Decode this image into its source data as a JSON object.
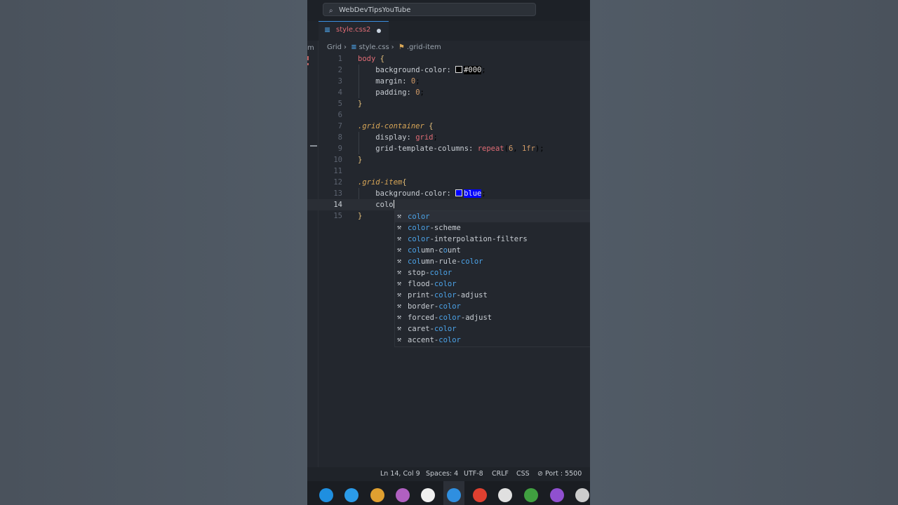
{
  "titlebar": {
    "search_text": "WebDevTipsYouTube"
  },
  "tab": {
    "label": "style.css",
    "problem_count": "2"
  },
  "sidebar_partial_text": "m",
  "breadcrumb": {
    "folder": "Grid",
    "file": "style.css",
    "symbol": ".grid-item"
  },
  "code_lines": [
    {
      "n": "1",
      "html": "<span class='sel'>body</span> <span class='brace'>{</span>"
    },
    {
      "n": "2",
      "html": "    <span class='prop'>background-color:</span> <span class='swatch' style='background:#000'></span><span class='hl-black'>#000</span>;"
    },
    {
      "n": "3",
      "html": "    <span class='prop'>margin:</span> <span class='num'>0</span>;"
    },
    {
      "n": "4",
      "html": "    <span class='prop'>padding:</span> <span class='num'>0</span>;"
    },
    {
      "n": "5",
      "html": "<span class='brace'>}</span>"
    },
    {
      "n": "6",
      "html": ""
    },
    {
      "n": "7",
      "html": "<span class='selc'>.grid-container</span> <span class='brace'>{</span>"
    },
    {
      "n": "8",
      "html": "    <span class='prop'>display:</span> <span class='val'>grid</span>;"
    },
    {
      "n": "9",
      "html": "    <span class='prop'>grid-template-columns:</span> <span class='fn'>repeat</span>(<span class='num'>6</span>, <span class='num'>1fr</span>);"
    },
    {
      "n": "10",
      "html": "<span class='brace'>}</span>"
    },
    {
      "n": "11",
      "html": ""
    },
    {
      "n": "12",
      "html": "<span class='selc'>.grid-item</span><span class='brace'>{</span>"
    },
    {
      "n": "13",
      "html": "    <span class='prop'>background-color:</span> <span class='swatch' style='background:#0000ff'></span><span class='hl-blue'>blue</span>;"
    },
    {
      "n": "14",
      "html": "    <span class='prop'>colo</span><span class='caret'></span>"
    },
    {
      "n": "15",
      "html": "<span class='brace'>}</span>"
    }
  ],
  "current_line": "14",
  "suggestions": [
    {
      "pre": "",
      "match": "color",
      "post": ""
    },
    {
      "pre": "",
      "match": "color",
      "post": "-scheme"
    },
    {
      "pre": "",
      "match": "color",
      "post": "-interpolation-filters"
    },
    {
      "pre": "",
      "match": "col",
      "post": "umn-c",
      "match2": "o",
      "post2": "unt"
    },
    {
      "pre": "",
      "match": "col",
      "post": "umn-rule-",
      "match2": "color",
      "post2": ""
    },
    {
      "pre": "stop-",
      "match": "color",
      "post": ""
    },
    {
      "pre": "flood-",
      "match": "color",
      "post": ""
    },
    {
      "pre": "print-",
      "match": "color",
      "post": "-adjust"
    },
    {
      "pre": "border-",
      "match": "color",
      "post": ""
    },
    {
      "pre": "forced-",
      "match": "color",
      "post": "-adjust"
    },
    {
      "pre": "caret-",
      "match": "color",
      "post": ""
    },
    {
      "pre": "accent-",
      "match": "color",
      "post": ""
    }
  ],
  "statusbar": {
    "position": "Ln 14, Col 9",
    "spaces": "Spaces: 4",
    "encoding": "UTF-8",
    "eol": "CRLF",
    "language": "CSS",
    "port": "Port : 5500"
  },
  "taskbar_icons": [
    {
      "name": "edge-icon",
      "color": "#1f8fe0"
    },
    {
      "name": "cortana-icon",
      "color": "#2b9be8"
    },
    {
      "name": "chrome-icon",
      "color": "#e0a030"
    },
    {
      "name": "app-purple-icon",
      "color": "#b060c0"
    },
    {
      "name": "app-white-icon",
      "color": "#f0f0f0"
    },
    {
      "name": "vscode-icon",
      "color": "#2f8fe0"
    },
    {
      "name": "chrome-2-icon",
      "color": "#e04030"
    },
    {
      "name": "whatsapp-icon",
      "color": "#e0e0e0"
    },
    {
      "name": "chrome-3-icon",
      "color": "#40a040"
    },
    {
      "name": "clapper-icon",
      "color": "#9050d0"
    },
    {
      "name": "settings-icon",
      "color": "#cccccc"
    }
  ]
}
